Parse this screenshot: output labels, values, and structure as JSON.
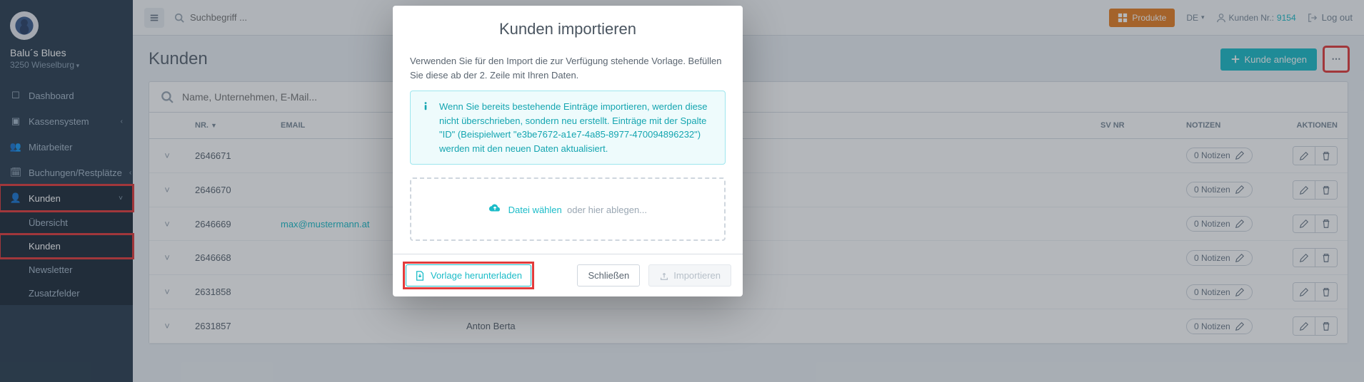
{
  "brand": {
    "name": "Balu´s Blues",
    "sub": "3250 Wieselburg"
  },
  "sidebar": {
    "items": [
      {
        "label": "Dashboard"
      },
      {
        "label": "Kassensystem"
      },
      {
        "label": "Mitarbeiter"
      },
      {
        "label": "Buchungen/Restplätze"
      },
      {
        "label": "Kunden"
      }
    ],
    "sub_kunden": [
      {
        "label": "Übersicht"
      },
      {
        "label": "Kunden"
      },
      {
        "label": "Newsletter"
      },
      {
        "label": "Zusatzfelder"
      }
    ]
  },
  "topbar": {
    "search_placeholder": "Suchbegriff ...",
    "products_label": "Produkte",
    "lang": "DE",
    "cust_nr_label": "Kunden Nr.:",
    "cust_nr_value": "9154",
    "logout": "Log out"
  },
  "page": {
    "title": "Kunden",
    "add_button": "Kunde anlegen"
  },
  "panel": {
    "search_placeholder": "Name, Unternehmen, E-Mail..."
  },
  "table": {
    "headers": {
      "nr": "NR.",
      "email": "EMAIL",
      "name": "",
      "svnr": "SV NR",
      "notes": "NOTIZEN",
      "actions": "AKTIONEN"
    },
    "note_label_prefix": "0 Notizen",
    "rows": [
      {
        "nr": "2646671",
        "email": "",
        "name": ""
      },
      {
        "nr": "2646670",
        "email": "",
        "name": ""
      },
      {
        "nr": "2646669",
        "email": "max@mustermann.at",
        "name": ""
      },
      {
        "nr": "2646668",
        "email": "",
        "name": ""
      },
      {
        "nr": "2631858",
        "email": "",
        "name": ""
      },
      {
        "nr": "2631857",
        "email": "",
        "name": "Anton Berta"
      }
    ]
  },
  "modal": {
    "title": "Kunden importieren",
    "intro": "Verwenden Sie für den Import die zur Verfügung stehende Vorlage. Befüllen Sie diese ab der 2. Zeile mit Ihren Daten.",
    "info": "Wenn Sie bereits bestehende Einträge importieren, werden diese nicht überschrieben, sondern neu erstellt. Einträge mit der Spalte \"ID\" (Beispielwert \"e3be7672-a1e7-4a85-8977-470094896232\") werden mit den neuen Daten aktualisiert.",
    "choose_file": "Datei wählen",
    "drop_hint": "oder hier ablegen...",
    "download_template": "Vorlage herunterladen",
    "close": "Schließen",
    "import": "Importieren"
  }
}
